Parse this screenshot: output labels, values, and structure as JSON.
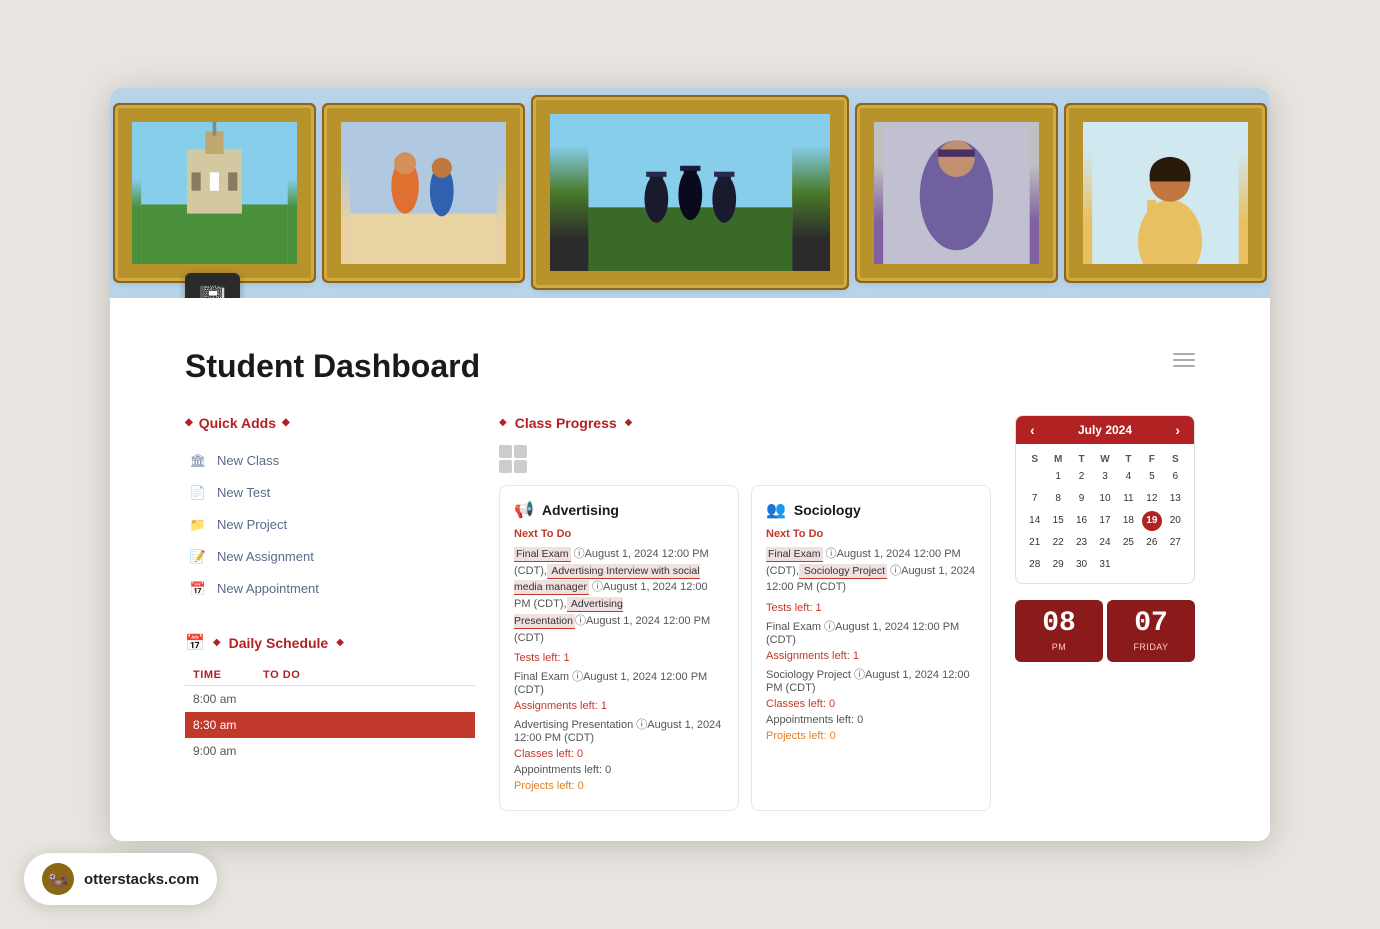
{
  "page": {
    "title": "Student Dashboard",
    "icon": "📓"
  },
  "banner": {
    "photos": [
      "campus",
      "students",
      "graduation",
      "celebration",
      "woman"
    ]
  },
  "quick_adds": {
    "section_title": "Quick Adds",
    "items": [
      {
        "id": "new-class",
        "label": "New Class",
        "icon": "🏛"
      },
      {
        "id": "new-test",
        "label": "New Test",
        "icon": "📄"
      },
      {
        "id": "new-project",
        "label": "New Project",
        "icon": "📁"
      },
      {
        "id": "new-assignment",
        "label": "New Assignment",
        "icon": "📝"
      },
      {
        "id": "new-appointment",
        "label": "New Appointment",
        "icon": "📅"
      }
    ]
  },
  "daily_schedule": {
    "section_title": "Daily Schedule",
    "col_time": "TIME",
    "col_todo": "TO DO",
    "rows": [
      {
        "time": "8:00 am",
        "todo": "",
        "highlight": false
      },
      {
        "time": "8:30 am",
        "todo": "",
        "highlight": true
      },
      {
        "time": "9:00 am",
        "todo": "",
        "highlight": false
      }
    ]
  },
  "class_progress": {
    "section_title": "Class Progress",
    "classes": [
      {
        "id": "advertising",
        "icon": "📢",
        "name": "Advertising",
        "next_to_do_label": "Next To Do",
        "items": [
          {
            "text": "Final Exam",
            "highlight": true,
            "suffix": " ⓘAugust 1, 2024 12:00 PM (CDT),"
          },
          {
            "text": " Advertising Interview with social media manager",
            "highlight": true,
            "suffix": " ⓘAugust 1, 2024 12:00 PM (CDT),"
          },
          {
            "text": " Advertising Presentation",
            "highlight": true,
            "suffix": "ⓘAugust 1, 2024 12:00 PM (CDT)"
          }
        ],
        "stats": [
          {
            "label": "Tests left:",
            "value": "1",
            "type": "red"
          },
          {
            "label": "Final Exam",
            "value": "ⓘAugust 1, 2024 12:00 PM (CDT)",
            "type": "neutral"
          },
          {
            "label": "Assignments left:",
            "value": "1",
            "type": "red"
          },
          {
            "label": "Advertising Presentation",
            "value": "ⓘAugust 1, 2024 12:00 PM (CDT)",
            "type": "neutral"
          },
          {
            "label": "Classes left:",
            "value": "0",
            "type": "red"
          },
          {
            "label": "Appointments left:",
            "value": "0",
            "type": "neutral"
          },
          {
            "label": "Projects left:",
            "value": "0",
            "type": "orange"
          }
        ]
      },
      {
        "id": "sociology",
        "icon": "👥",
        "name": "Sociology",
        "next_to_do_label": "Next To Do",
        "items": [
          {
            "text": "Final Exam",
            "highlight": true,
            "suffix": " ⓘAugust 1, 2024 12:00 PM (CDT),"
          },
          {
            "text": " Sociology Project",
            "highlight": true,
            "suffix": " ⓘAugust 1, 2024 12:00 PM (CDT)"
          }
        ],
        "stats": [
          {
            "label": "Tests left:",
            "value": "1",
            "type": "red"
          },
          {
            "label": "Final Exam",
            "value": "ⓘAugust 1, 2024 12:00 PM (CDT)",
            "type": "neutral"
          },
          {
            "label": "Assignments left:",
            "value": "1",
            "type": "red"
          },
          {
            "label": "Sociology Project",
            "value": "ⓘAugust 1, 2024 12:00 PM (CDT)",
            "type": "neutral"
          },
          {
            "label": "Classes left:",
            "value": "0",
            "type": "red"
          },
          {
            "label": "Appointments left:",
            "value": "0",
            "type": "neutral"
          },
          {
            "label": "Projects left:",
            "value": "0",
            "type": "orange"
          }
        ]
      }
    ]
  },
  "calendar": {
    "month": "July 2024",
    "prev_label": "‹",
    "next_label": "›",
    "day_headers": [
      "S",
      "M",
      "T",
      "W",
      "T",
      "F",
      "S"
    ],
    "weeks": [
      [
        "",
        "1",
        "2",
        "3",
        "4",
        "5",
        "6"
      ],
      [
        "7",
        "8",
        "9",
        "10",
        "11",
        "12",
        "13"
      ],
      [
        "14",
        "15",
        "16",
        "17",
        "18",
        "19",
        "20"
      ],
      [
        "21",
        "22",
        "23",
        "24",
        "25",
        "26",
        "27"
      ],
      [
        "28",
        "29",
        "30",
        "31",
        "",
        "",
        ""
      ]
    ],
    "today": "19"
  },
  "clock": {
    "hour": "08",
    "hour_label": "PM",
    "day": "07",
    "day_label": "FRIDAY"
  },
  "watermark": {
    "site": "otterstacks.com",
    "icon": "🦦"
  }
}
